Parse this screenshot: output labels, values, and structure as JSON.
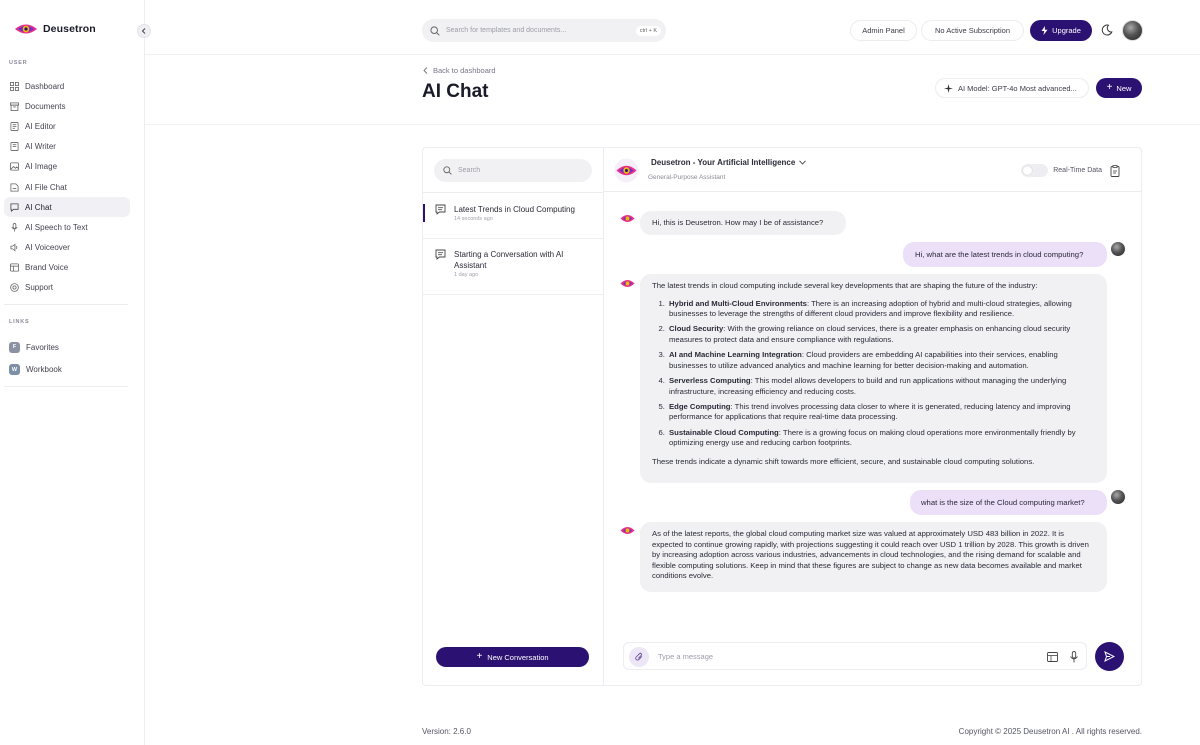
{
  "app": {
    "name": "Deusetron"
  },
  "sidebar": {
    "user_section_label": "USER",
    "items": [
      {
        "label": "Dashboard",
        "icon": "dashboard-icon"
      },
      {
        "label": "Documents",
        "icon": "documents-icon"
      },
      {
        "label": "AI Editor",
        "icon": "editor-icon"
      },
      {
        "label": "AI Writer",
        "icon": "writer-icon"
      },
      {
        "label": "AI Image",
        "icon": "image-icon"
      },
      {
        "label": "AI File Chat",
        "icon": "file-chat-icon"
      },
      {
        "label": "AI Chat",
        "icon": "chat-icon",
        "active": true
      },
      {
        "label": "AI Speech to Text",
        "icon": "microphone-icon"
      },
      {
        "label": "AI Voiceover",
        "icon": "speaker-icon"
      },
      {
        "label": "Brand Voice",
        "icon": "brand-voice-icon"
      },
      {
        "label": "Support",
        "icon": "support-icon"
      }
    ],
    "links_section_label": "LINKS",
    "links": [
      {
        "badge": "F",
        "label": "Favorites"
      },
      {
        "badge": "W",
        "label": "Workbook"
      }
    ]
  },
  "topbar": {
    "search_placeholder": "Search for templates and documents...",
    "search_shortcut": "ctrl + K",
    "admin_panel": "Admin Panel",
    "subscription": "No Active Subscription",
    "upgrade": "Upgrade"
  },
  "page": {
    "back_link": "Back to dashboard",
    "title": "AI Chat",
    "model_label": "AI Model: GPT-4o Most advanced...",
    "new_button": "New"
  },
  "conversations": {
    "search_placeholder": "Search",
    "items": [
      {
        "title": "Latest Trends in Cloud Computing",
        "time": "14 seconds ago",
        "active": true
      },
      {
        "title": "Starting a Conversation with AI Assistant",
        "time": "1 day ago",
        "active": false
      }
    ],
    "new_conversation": "New Conversation"
  },
  "chat": {
    "assistant_name": "Deusetron - Your Artificial Intelligence",
    "assistant_subtitle": "General-Purpose Assistant",
    "realtime_label": "Real-Time Data",
    "messages": {
      "m1": "Hi, this is Deusetron. How may I be of assistance?",
      "m2": "Hi, what are the latest trends in cloud computing?",
      "m3_intro": "The latest trends in cloud computing include several key developments that are shaping the future of the industry:",
      "m3_items": [
        {
          "title": "Hybrid and Multi-Cloud Environments",
          "text": ": There is an increasing adoption of hybrid and multi-cloud strategies, allowing businesses to leverage the strengths of different cloud providers and improve flexibility and resilience."
        },
        {
          "title": "Cloud Security",
          "text": ": With the growing reliance on cloud services, there is a greater emphasis on enhancing cloud security measures to protect data and ensure compliance with regulations."
        },
        {
          "title": "AI and Machine Learning Integration",
          "text": ": Cloud providers are embedding AI capabilities into their services, enabling businesses to utilize advanced analytics and machine learning for better decision-making and automation."
        },
        {
          "title": "Serverless Computing",
          "text": ": This model allows developers to build and run applications without managing the underlying infrastructure, increasing efficiency and reducing costs."
        },
        {
          "title": "Edge Computing",
          "text": ": This trend involves processing data closer to where it is generated, reducing latency and improving performance for applications that require real-time data processing."
        },
        {
          "title": "Sustainable Cloud Computing",
          "text": ": There is a growing focus on making cloud operations more environmentally friendly by optimizing energy use and reducing carbon footprints."
        }
      ],
      "m3_outro": "These trends indicate a dynamic shift towards more efficient, secure, and sustainable cloud computing solutions.",
      "m4": "what is the size of the Cloud computing market?",
      "m5": "As of the latest reports, the global cloud computing market size was valued at approximately USD 483 billion in 2022. It is expected to continue growing rapidly, with projections suggesting it could reach over USD 1 trillion by 2028. This growth is driven by increasing adoption across various industries, advancements in cloud technologies, and the rising demand for scalable and flexible computing solutions. Keep in mind that these figures are subject to change as new data becomes available and market conditions evolve."
    },
    "composer_placeholder": "Type a message"
  },
  "footer": {
    "version": "Version: 2.6.0",
    "copyright": "Copyright © 2025 Deusetron AI . All rights reserved."
  },
  "colors": {
    "brand": "#2b1272",
    "user_bubble": "#ecdff8",
    "bot_bubble": "#f1f1f4"
  }
}
